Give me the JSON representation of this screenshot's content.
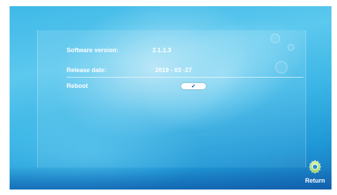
{
  "info": {
    "software_version_label": "Software version:",
    "software_version_value": "2.1.1.3",
    "release_date_label": "Release date:",
    "release_date_value": "2019 - 03 -27",
    "reboot_label": "Reboot"
  },
  "controls": {
    "reboot_toggle_icon": "checkmark-icon",
    "return_icon": "gear-icon",
    "return_label": "Return"
  },
  "colors": {
    "background": "#3cb6e6",
    "text": "#ffffff",
    "toggle": "#ffffff",
    "checkmark": "#1a5fb0"
  }
}
